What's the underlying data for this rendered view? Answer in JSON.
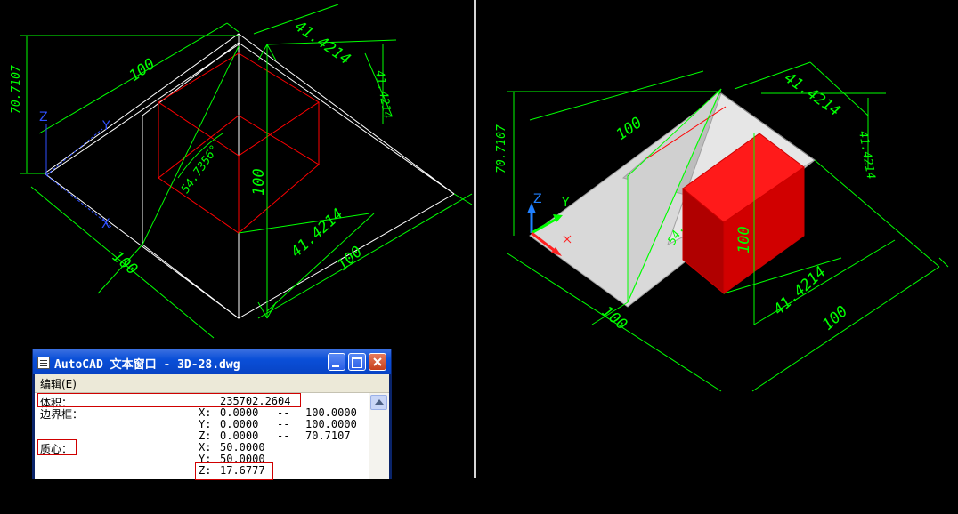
{
  "viewports": {
    "left": {
      "dims": {
        "top_width": "100",
        "height_left": "70.7107",
        "top_right_a": "41.4214",
        "top_right_b": "41.4214",
        "angle": "54.7356°",
        "center_height": "100",
        "mid_diag": "41.4214",
        "bottom_right": "100",
        "bottom_left": "100"
      },
      "ucs": {
        "z": "Z",
        "y": "Y",
        "x": "X"
      }
    },
    "right": {
      "dims": {
        "top_width": "100",
        "height_left": "70.7107",
        "top_right_a": "41.4214",
        "top_right_b": "41.4214",
        "angle_partial": "54.",
        "box_height": "100",
        "mid_diag": "41.4214",
        "bottom_right": "100",
        "bottom_left": "100"
      },
      "ucs": {
        "z": "Z",
        "y": "Y"
      }
    }
  },
  "text_window": {
    "title": "AutoCAD 文本窗口 - 3D-28.dwg",
    "menu": {
      "edit": "编辑(E)"
    },
    "rows": [
      {
        "label": "体积：",
        "axis": "",
        "value": "235702.2604",
        "dash": "",
        "max": ""
      },
      {
        "label": "边界框：",
        "axis": "X:",
        "value": "0.0000",
        "dash": "--",
        "max": "100.0000"
      },
      {
        "label": "",
        "axis": "Y:",
        "value": "0.0000",
        "dash": "--",
        "max": "100.0000"
      },
      {
        "label": "",
        "axis": "Z:",
        "value": "0.0000",
        "dash": "--",
        "max": "70.7107"
      },
      {
        "label": "质心：",
        "axis": "X:",
        "value": "50.0000",
        "dash": "",
        "max": ""
      },
      {
        "label": "",
        "axis": "Y:",
        "value": "50.0000",
        "dash": "",
        "max": ""
      },
      {
        "label": "",
        "axis": "Z:",
        "value": "17.6777",
        "dash": "",
        "max": ""
      }
    ]
  },
  "colors": {
    "dimension": "#00ff00",
    "edge": "#ffffff",
    "red_edge": "#ff0000",
    "fill_gray": "#d9d9d9",
    "fill_red": "#e00000"
  }
}
